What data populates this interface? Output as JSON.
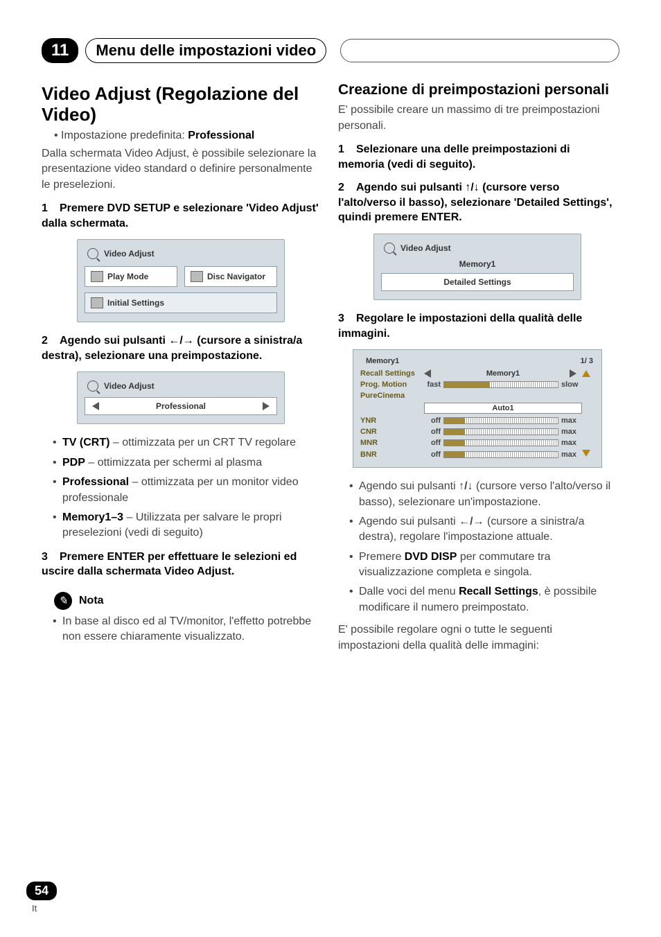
{
  "chapter": {
    "number": "11",
    "title": "Menu delle impostazioni video"
  },
  "left": {
    "heading": "Video Adjust (Regolazione del Video)",
    "default_line_prefix": "• Impostazione predefinita: ",
    "default_value": "Professional",
    "intro": "Dalla schermata Video Adjust, è possibile selezionare la presentazione video standard o definire personalmente le preselezioni.",
    "step1": "Premere DVD SETUP e selezionare 'Video Adjust' dalla schermata.",
    "ss1": {
      "title": "Video Adjust",
      "play_mode": "Play Mode",
      "disc_nav": "Disc Navigator",
      "initial": "Initial Settings"
    },
    "step2_pre": "Agendo sui pulsanti ",
    "step2_arrows": "←/→",
    "step2_post": " (cursore a sinistra/a destra), selezionare una preimpostazione.",
    "ss2": {
      "title": "Video Adjust",
      "value": "Professional"
    },
    "options": [
      {
        "name": "TV (CRT)",
        "desc": " – ottimizzata per un CRT TV regolare"
      },
      {
        "name": "PDP",
        "desc": " – ottimizzata per schermi al plasma"
      },
      {
        "name": "Professional",
        "desc": " – ottimizzata per un monitor video professionale"
      },
      {
        "name": "Memory1–3",
        "desc": " – Utilizzata per salvare le propri preselezioni (vedi di seguito)"
      }
    ],
    "step3": "Premere ENTER per effettuare le selezioni ed uscire dalla schermata Video Adjust.",
    "note_title": "Nota",
    "note_body": "In base al disco ed al TV/monitor, l'effetto potrebbe non essere chiaramente visualizzato."
  },
  "right": {
    "heading": "Creazione di preimpostazioni personali",
    "intro": "E' possibile creare un massimo di tre preimpostazioni personali.",
    "step1": "Selezionare una delle preimpostazioni di memoria (vedi di seguito).",
    "step2_pre": "Agendo sui pulsanti ",
    "step2_arrows": "↑/↓",
    "step2_post": " (cursore verso l'alto/verso il basso), selezionare 'Detailed Settings', quindi premere ENTER.",
    "ss3": {
      "title": "Video Adjust",
      "mem": "Memory1",
      "detailed": "Detailed Settings"
    },
    "step3": "Regolare le impostazioni della qualità delle immagini.",
    "ss4": {
      "title": "Memory1",
      "page": "1/ 3",
      "recall": "Recall Settings",
      "mem": "Memory1",
      "rows": [
        {
          "label": "Prog. Motion",
          "left": "fast",
          "right": "slow",
          "fill": 40
        },
        {
          "label": "PureCinema",
          "auto": "Auto1"
        },
        {
          "label": "YNR",
          "left": "off",
          "right": "max",
          "fill": 18
        },
        {
          "label": "CNR",
          "left": "off",
          "right": "max",
          "fill": 18
        },
        {
          "label": "MNR",
          "left": "off",
          "right": "max",
          "fill": 18
        },
        {
          "label": "BNR",
          "left": "off",
          "right": "max",
          "fill": 18
        }
      ]
    },
    "bullets": [
      {
        "pre": "Agendo sui pulsanti ",
        "arr": "↑/↓",
        "post": " (cursore verso l'alto/verso il basso), selezionare un'impostazione."
      },
      {
        "pre": "Agendo sui pulsanti ",
        "arr": "←/→",
        "post": " (cursore a sinistra/a destra), regolare l'impostazione attuale."
      },
      {
        "pre": "Premere ",
        "bold": "DVD DISP",
        "post": " per commutare tra visualizzazione completa e singola."
      },
      {
        "pre": "Dalle voci del menu ",
        "bold": "Recall Settings",
        "post": ", è possibile modificare il numero preimpostato."
      }
    ],
    "outro": "E' possibile regolare ogni o tutte le seguenti impostazioni della qualità delle immagini:"
  },
  "footer": {
    "page": "54",
    "lang": "It"
  },
  "labels": {
    "s1": "1",
    "s2": "2",
    "s3": "3"
  }
}
